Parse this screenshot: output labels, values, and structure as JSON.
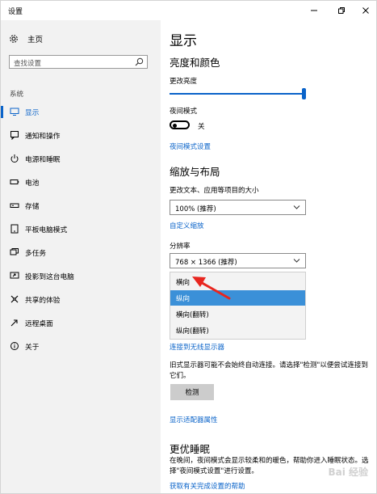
{
  "window": {
    "title": "设置",
    "minimize_icon": "minimize-icon",
    "maximize_icon": "restore-icon",
    "close_icon": "close-icon"
  },
  "sidebar": {
    "home_label": "主页",
    "search_placeholder": "查找设置",
    "section_label": "系统",
    "items": [
      {
        "label": "显示",
        "icon": "monitor-icon",
        "active": true
      },
      {
        "label": "通知和操作",
        "icon": "notification-icon",
        "active": false
      },
      {
        "label": "电源和睡眠",
        "icon": "power-icon",
        "active": false
      },
      {
        "label": "电池",
        "icon": "battery-icon",
        "active": false
      },
      {
        "label": "存储",
        "icon": "storage-icon",
        "active": false
      },
      {
        "label": "平板电脑模式",
        "icon": "tablet-icon",
        "active": false
      },
      {
        "label": "多任务",
        "icon": "multitask-icon",
        "active": false
      },
      {
        "label": "投影到这台电脑",
        "icon": "project-icon",
        "active": false
      },
      {
        "label": "共享的体验",
        "icon": "shared-icon",
        "active": false
      },
      {
        "label": "远程桌面",
        "icon": "remote-desktop-icon",
        "active": false
      },
      {
        "label": "关于",
        "icon": "info-icon",
        "active": false
      }
    ]
  },
  "main": {
    "title": "显示",
    "brightness_heading": "亮度和颜色",
    "brightness_label": "更改亮度",
    "brightness_level": 1.0,
    "night_mode_label": "夜间模式",
    "night_mode_state": "关",
    "night_mode_link": "夜间模式设置",
    "scale_heading": "缩放与布局",
    "scale_label": "更改文本、应用等项目的大小",
    "scale_value": "100% (推荐)",
    "custom_scale_link": "自定义缩放",
    "resolution_label": "分辨率",
    "resolution_value": "768 × 1366 (推荐)",
    "orientation_options": [
      "横向",
      "纵向",
      "横向(翻转)",
      "纵向(翻转)"
    ],
    "orientation_highlighted": "纵向",
    "wireless_link": "连接到无线显示器",
    "legacy_text": "旧式显示器可能不会始终自动连接。请选择\"检测\"以便尝试连接到它们。",
    "detect_button": "检测",
    "adapter_link": "显示适配器属性",
    "sleep_heading": "更优睡眠",
    "sleep_text": "在晚间，夜间模式会显示较柔和的暖色，帮助你进入睡眠状态。选择\"夜间模式设置\"进行设置。",
    "sleep_link": "获取有关完成设置的帮助"
  },
  "colors": {
    "accent": "#0a63c9",
    "selection": "#3b90d8",
    "sidebar_bg": "#f2f2f2",
    "annotation_arrow": "#e8261f"
  },
  "watermark": "Bai 经验"
}
